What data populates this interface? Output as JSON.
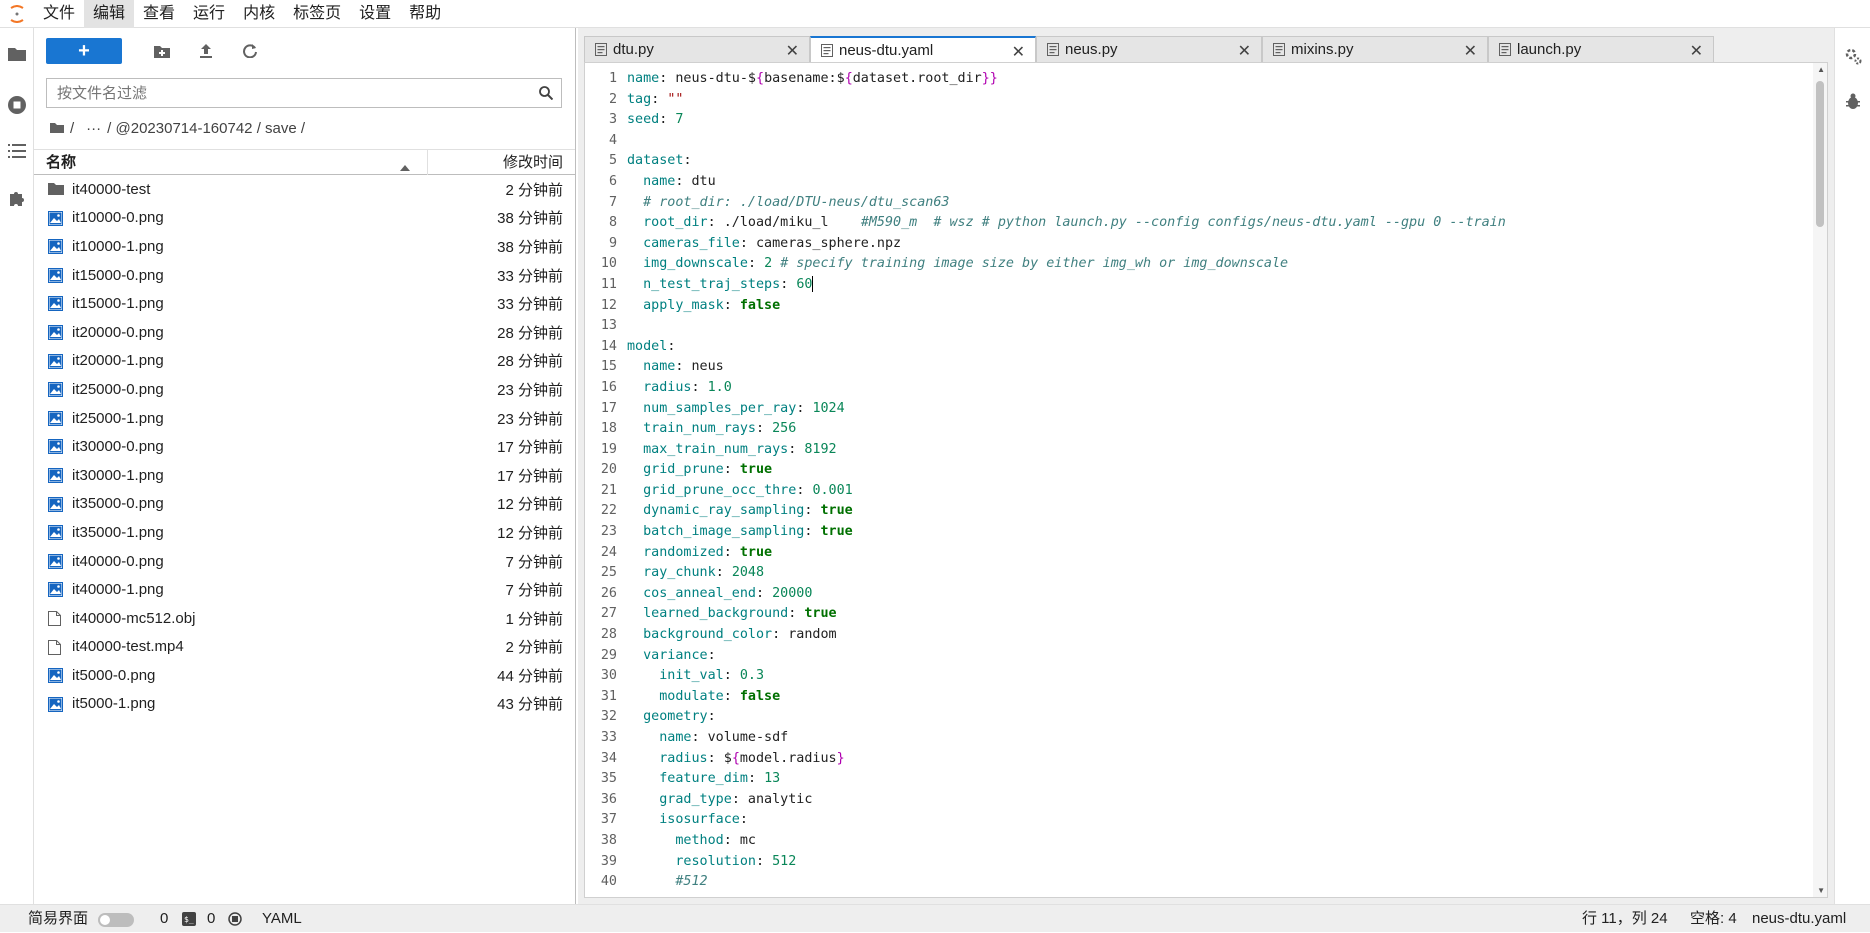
{
  "menubar": {
    "items": [
      "文件",
      "编辑",
      "查看",
      "运行",
      "内核",
      "标签页",
      "设置",
      "帮助"
    ],
    "active_index": 1
  },
  "left_bar": {
    "icons": [
      "folder-icon",
      "running-icon",
      "toc-icon",
      "extension-icon"
    ]
  },
  "filebrowser": {
    "new_label": "+",
    "search_placeholder": "按文件名过滤",
    "breadcrumb": [
      "/",
      "···",
      "/ @20230714-160742 / save /"
    ],
    "columns": {
      "name": "名称",
      "modified": "修改时间"
    },
    "files": [
      {
        "name": "it40000-test",
        "time": "2 分钟前",
        "type": "folder"
      },
      {
        "name": "it10000-0.png",
        "time": "38 分钟前",
        "type": "image"
      },
      {
        "name": "it10000-1.png",
        "time": "38 分钟前",
        "type": "image"
      },
      {
        "name": "it15000-0.png",
        "time": "33 分钟前",
        "type": "image"
      },
      {
        "name": "it15000-1.png",
        "time": "33 分钟前",
        "type": "image"
      },
      {
        "name": "it20000-0.png",
        "time": "28 分钟前",
        "type": "image"
      },
      {
        "name": "it20000-1.png",
        "time": "28 分钟前",
        "type": "image"
      },
      {
        "name": "it25000-0.png",
        "time": "23 分钟前",
        "type": "image"
      },
      {
        "name": "it25000-1.png",
        "time": "23 分钟前",
        "type": "image"
      },
      {
        "name": "it30000-0.png",
        "time": "17 分钟前",
        "type": "image"
      },
      {
        "name": "it30000-1.png",
        "time": "17 分钟前",
        "type": "image"
      },
      {
        "name": "it35000-0.png",
        "time": "12 分钟前",
        "type": "image"
      },
      {
        "name": "it35000-1.png",
        "time": "12 分钟前",
        "type": "image"
      },
      {
        "name": "it40000-0.png",
        "time": "7 分钟前",
        "type": "image"
      },
      {
        "name": "it40000-1.png",
        "time": "7 分钟前",
        "type": "image"
      },
      {
        "name": "it40000-mc512.obj",
        "time": "1 分钟前",
        "type": "file"
      },
      {
        "name": "it40000-test.mp4",
        "time": "2 分钟前",
        "type": "file"
      },
      {
        "name": "it5000-0.png",
        "time": "44 分钟前",
        "type": "image"
      },
      {
        "name": "it5000-1.png",
        "time": "43 分钟前",
        "type": "image"
      }
    ]
  },
  "tabs": [
    {
      "label": "dtu.py",
      "active": false
    },
    {
      "label": "neus-dtu.yaml",
      "active": true
    },
    {
      "label": "neus.py",
      "active": false
    },
    {
      "label": "mixins.py",
      "active": false
    },
    {
      "label": "launch.py",
      "active": false
    }
  ],
  "code_lines": [
    [
      [
        "k",
        "name"
      ],
      [
        "v",
        ": neus-dtu-$"
      ],
      [
        "br",
        "{"
      ],
      [
        "v",
        "basename:$"
      ],
      [
        "br",
        "{"
      ],
      [
        "v",
        "dataset.root_dir"
      ],
      [
        "br",
        "}}"
      ]
    ],
    [
      [
        "k",
        "tag"
      ],
      [
        "v",
        ": "
      ],
      [
        "s",
        "\"\""
      ]
    ],
    [
      [
        "k",
        "seed"
      ],
      [
        "v",
        ": "
      ],
      [
        "n",
        "7"
      ]
    ],
    [],
    [
      [
        "k",
        "dataset"
      ],
      [
        "v",
        ":"
      ]
    ],
    [
      [
        "v",
        "  "
      ],
      [
        "k",
        "name"
      ],
      [
        "v",
        ": dtu"
      ]
    ],
    [
      [
        "v",
        "  "
      ],
      [
        "c",
        "# root_dir: ./load/DTU-neus/dtu_scan63"
      ]
    ],
    [
      [
        "v",
        "  "
      ],
      [
        "k",
        "root_dir"
      ],
      [
        "v",
        ": ./load/miku_l    "
      ],
      [
        "c",
        "#M590_m  # wsz # python launch.py --config configs/neus-dtu.yaml --gpu 0 --train"
      ]
    ],
    [
      [
        "v",
        "  "
      ],
      [
        "k",
        "cameras_file"
      ],
      [
        "v",
        ": cameras_sphere.npz"
      ]
    ],
    [
      [
        "v",
        "  "
      ],
      [
        "k",
        "img_downscale"
      ],
      [
        "v",
        ": "
      ],
      [
        "n",
        "2"
      ],
      [
        "v",
        " "
      ],
      [
        "c",
        "# specify training image size by either img_wh or img_downscale"
      ]
    ],
    [
      [
        "v",
        "  "
      ],
      [
        "k",
        "n_test_traj_steps"
      ],
      [
        "v",
        ": "
      ],
      [
        "n",
        "60"
      ],
      [
        "cursor",
        ""
      ]
    ],
    [
      [
        "v",
        "  "
      ],
      [
        "k",
        "apply_mask"
      ],
      [
        "v",
        ": "
      ],
      [
        "b",
        "false"
      ]
    ],
    [],
    [
      [
        "k",
        "model"
      ],
      [
        "v",
        ":"
      ]
    ],
    [
      [
        "v",
        "  "
      ],
      [
        "k",
        "name"
      ],
      [
        "v",
        ": neus"
      ]
    ],
    [
      [
        "v",
        "  "
      ],
      [
        "k",
        "radius"
      ],
      [
        "v",
        ": "
      ],
      [
        "n",
        "1.0"
      ]
    ],
    [
      [
        "v",
        "  "
      ],
      [
        "k",
        "num_samples_per_ray"
      ],
      [
        "v",
        ": "
      ],
      [
        "n",
        "1024"
      ]
    ],
    [
      [
        "v",
        "  "
      ],
      [
        "k",
        "train_num_rays"
      ],
      [
        "v",
        ": "
      ],
      [
        "n",
        "256"
      ]
    ],
    [
      [
        "v",
        "  "
      ],
      [
        "k",
        "max_train_num_rays"
      ],
      [
        "v",
        ": "
      ],
      [
        "n",
        "8192"
      ]
    ],
    [
      [
        "v",
        "  "
      ],
      [
        "k",
        "grid_prune"
      ],
      [
        "v",
        ": "
      ],
      [
        "b",
        "true"
      ]
    ],
    [
      [
        "v",
        "  "
      ],
      [
        "k",
        "grid_prune_occ_thre"
      ],
      [
        "v",
        ": "
      ],
      [
        "n",
        "0.001"
      ]
    ],
    [
      [
        "v",
        "  "
      ],
      [
        "k",
        "dynamic_ray_sampling"
      ],
      [
        "v",
        ": "
      ],
      [
        "b",
        "true"
      ]
    ],
    [
      [
        "v",
        "  "
      ],
      [
        "k",
        "batch_image_sampling"
      ],
      [
        "v",
        ": "
      ],
      [
        "b",
        "true"
      ]
    ],
    [
      [
        "v",
        "  "
      ],
      [
        "k",
        "randomized"
      ],
      [
        "v",
        ": "
      ],
      [
        "b",
        "true"
      ]
    ],
    [
      [
        "v",
        "  "
      ],
      [
        "k",
        "ray_chunk"
      ],
      [
        "v",
        ": "
      ],
      [
        "n",
        "2048"
      ]
    ],
    [
      [
        "v",
        "  "
      ],
      [
        "k",
        "cos_anneal_end"
      ],
      [
        "v",
        ": "
      ],
      [
        "n",
        "20000"
      ]
    ],
    [
      [
        "v",
        "  "
      ],
      [
        "k",
        "learned_background"
      ],
      [
        "v",
        ": "
      ],
      [
        "b",
        "true"
      ]
    ],
    [
      [
        "v",
        "  "
      ],
      [
        "k",
        "background_color"
      ],
      [
        "v",
        ": random"
      ]
    ],
    [
      [
        "v",
        "  "
      ],
      [
        "k",
        "variance"
      ],
      [
        "v",
        ":"
      ]
    ],
    [
      [
        "v",
        "    "
      ],
      [
        "k",
        "init_val"
      ],
      [
        "v",
        ": "
      ],
      [
        "n",
        "0.3"
      ]
    ],
    [
      [
        "v",
        "    "
      ],
      [
        "k",
        "modulate"
      ],
      [
        "v",
        ": "
      ],
      [
        "b",
        "false"
      ]
    ],
    [
      [
        "v",
        "  "
      ],
      [
        "k",
        "geometry"
      ],
      [
        "v",
        ":"
      ]
    ],
    [
      [
        "v",
        "    "
      ],
      [
        "k",
        "name"
      ],
      [
        "v",
        ": volume-sdf"
      ]
    ],
    [
      [
        "v",
        "    "
      ],
      [
        "k",
        "radius"
      ],
      [
        "v",
        ": $"
      ],
      [
        "br",
        "{"
      ],
      [
        "v",
        "model.radius"
      ],
      [
        "br",
        "}"
      ]
    ],
    [
      [
        "v",
        "    "
      ],
      [
        "k",
        "feature_dim"
      ],
      [
        "v",
        ": "
      ],
      [
        "n",
        "13"
      ]
    ],
    [
      [
        "v",
        "    "
      ],
      [
        "k",
        "grad_type"
      ],
      [
        "v",
        ": analytic"
      ]
    ],
    [
      [
        "v",
        "    "
      ],
      [
        "k",
        "isosurface"
      ],
      [
        "v",
        ":"
      ]
    ],
    [
      [
        "v",
        "      "
      ],
      [
        "k",
        "method"
      ],
      [
        "v",
        ": mc"
      ]
    ],
    [
      [
        "v",
        "      "
      ],
      [
        "k",
        "resolution"
      ],
      [
        "v",
        ": "
      ],
      [
        "n",
        "512"
      ]
    ],
    [
      [
        "v",
        "      "
      ],
      [
        "c",
        "#512"
      ]
    ]
  ],
  "statusbar": {
    "simple_mode_label": "简易界面",
    "simple_mode_on": false,
    "kernel_count": "0",
    "terminal_count": "0",
    "file_type": "YAML",
    "cursor_position": "行 11，列 24",
    "indent": "空格: 4",
    "filename": "neus-dtu.yaml"
  },
  "colors": {
    "accent": "#1976d2",
    "yaml_key": "#008080",
    "yaml_number": "#098658",
    "yaml_bool": "#007000",
    "yaml_comment": "#408080",
    "yaml_string": "#a31515"
  }
}
